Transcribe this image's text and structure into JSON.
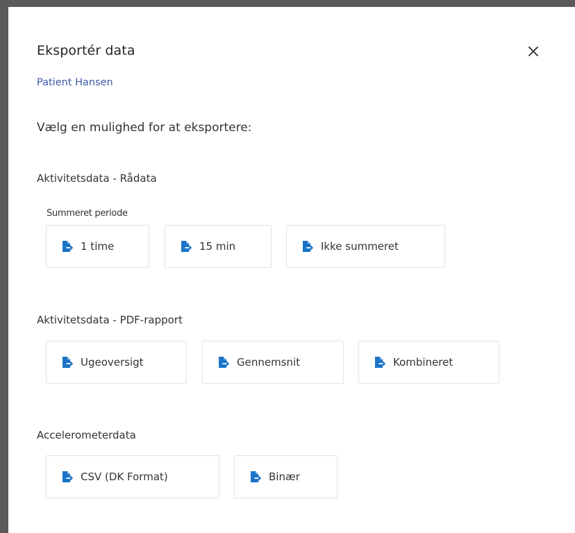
{
  "dialog": {
    "title": "Eksportér data",
    "subtitle": "Patient Hansen",
    "prompt": "Vælg en mulighed for at eksportere:",
    "close_icon": "close-icon"
  },
  "sections": [
    {
      "title": "Aktivitetsdata - Rådata",
      "sub_label": "Summeret periode",
      "buttons": [
        {
          "label": "1 time",
          "icon": "file-export-icon"
        },
        {
          "label": "15 min",
          "icon": "file-export-icon"
        },
        {
          "label": "Ikke summeret",
          "icon": "file-export-icon"
        }
      ]
    },
    {
      "title": "Aktivitetsdata - PDF-rapport",
      "buttons": [
        {
          "label": "Ugeoversigt",
          "icon": "file-export-icon"
        },
        {
          "label": "Gennemsnit",
          "icon": "file-export-icon"
        },
        {
          "label": "Kombineret",
          "icon": "file-export-icon"
        }
      ]
    },
    {
      "title": "Accelerometerdata",
      "buttons": [
        {
          "label": "CSV (DK Format)",
          "icon": "file-export-icon"
        },
        {
          "label": "Binær",
          "icon": "file-export-icon"
        }
      ]
    }
  ],
  "colors": {
    "accent": "#1a73c8",
    "subtitle": "#3d5aa8",
    "text": "#333333",
    "border": "#e3e3e3"
  }
}
